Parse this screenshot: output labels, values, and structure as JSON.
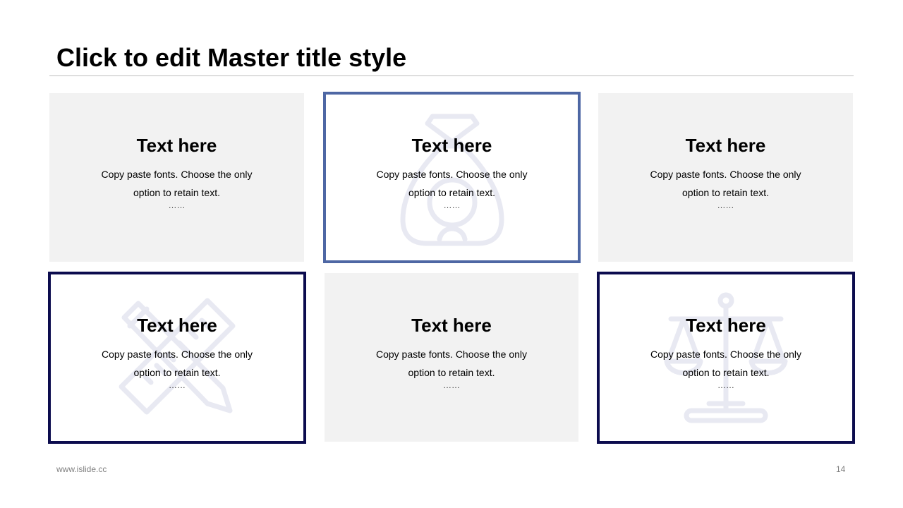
{
  "slide": {
    "title": "Click to edit Master title style",
    "footer_url": "www.islide.cc",
    "page_number": "14"
  },
  "cards": [
    {
      "heading": "Text here",
      "line1": "Copy paste fonts. Choose the only",
      "line2": "option to retain text.",
      "dots": "……",
      "style": "gray",
      "icon": "none"
    },
    {
      "heading": "Text here",
      "line1": "Copy paste fonts. Choose the only",
      "line2": "option to retain text.",
      "dots": "……",
      "style": "outlined-light",
      "icon": "money-bag-icon"
    },
    {
      "heading": "Text here",
      "line1": "Copy paste fonts. Choose the only",
      "line2": "option to retain text.",
      "dots": "……",
      "style": "gray",
      "icon": "none"
    },
    {
      "heading": "Text here",
      "line1": "Copy paste fonts. Choose the only",
      "line2": "option to retain text.",
      "dots": "……",
      "style": "outlined-dark",
      "icon": "ruler-pencil-icon"
    },
    {
      "heading": "Text here",
      "line1": "Copy paste fonts. Choose the only",
      "line2": "option to retain text.",
      "dots": "……",
      "style": "gray",
      "icon": "none"
    },
    {
      "heading": "Text here",
      "line1": "Copy paste fonts. Choose the only",
      "line2": "option to retain text.",
      "dots": "……",
      "style": "outlined-dark",
      "icon": "scales-icon"
    }
  ],
  "colors": {
    "accent_light": "#4e67a4",
    "accent_dark": "#0c0c4e",
    "card_gray": "#f2f2f2",
    "icon_tint": "#e8e9f2"
  }
}
